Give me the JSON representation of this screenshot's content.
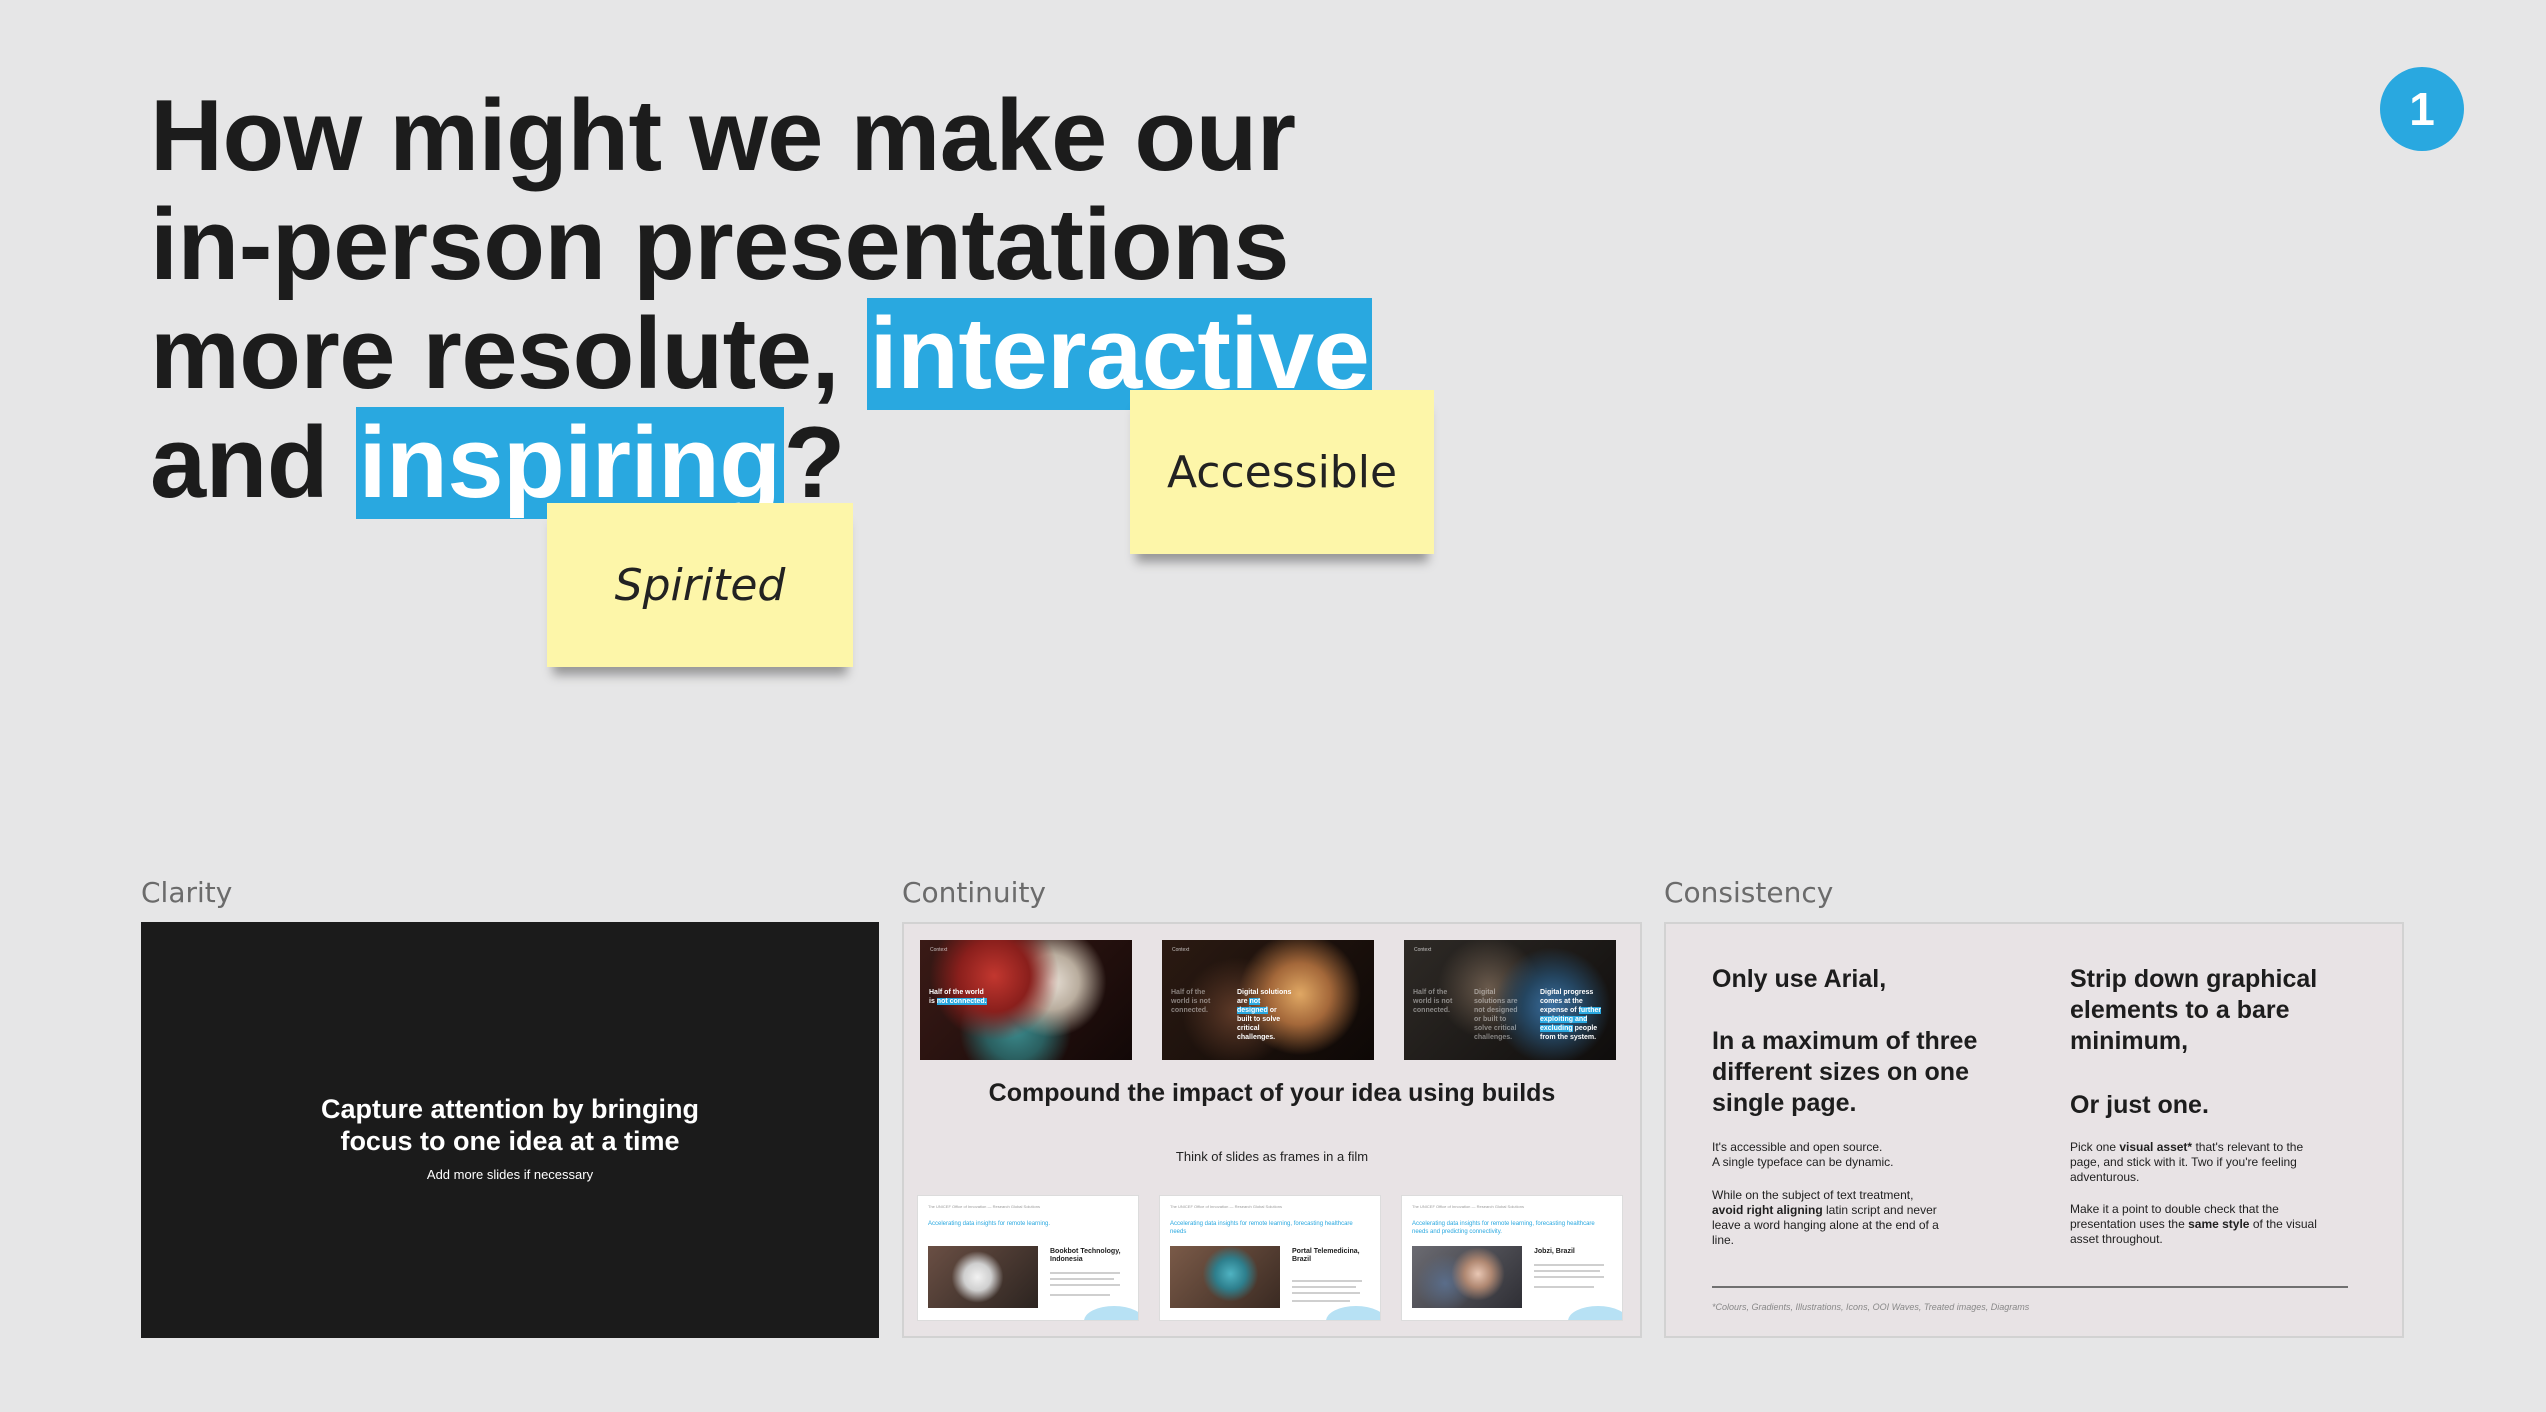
{
  "headline": {
    "line1": "How might we make our",
    "line2": "in-person presentations",
    "line3_prefix": "more resolute, ",
    "line3_highlight": "interactive",
    "line4_prefix": "and ",
    "line4_highlight": "inspiring",
    "line4_suffix": "?"
  },
  "badge": "1",
  "stickies": {
    "accessible": "Accessible",
    "spirited": "Spirited"
  },
  "colors": {
    "accent": "#29a8e0",
    "sticky": "#fdf6a9",
    "background": "#e6e6e7"
  },
  "sections": {
    "clarity": {
      "label": "Clarity",
      "title": "Capture attention by bringing focus to one idea at a time",
      "subtitle": "Add more slides if necessary"
    },
    "continuity": {
      "label": "Continuity",
      "title": "Compound the impact of your idea using builds",
      "subtitle": "Think of slides as frames in a film",
      "photo_slides": [
        {
          "label": "Context",
          "text_plain": "Half of the world is",
          "text_highlight": "not connected."
        },
        {
          "label": "Context",
          "left_plain": "Half of the world is",
          "left_highlight": "not connected.",
          "right_prefix": "Digital solutions are",
          "right_highlight": "not designed",
          "right_suffix": "or built to solve critical challenges."
        },
        {
          "label": "Context",
          "left_plain": "Half of the world is",
          "left_highlight": "not connected.",
          "mid_text": "Digital solutions are not designed or built to solve critical challenges.",
          "right_prefix": "Digital progress comes at the expense of",
          "right_highlight": "further exploiting and excluding",
          "right_suffix": "people from the system."
        }
      ],
      "doc_slides": [
        {
          "crumb": "The UNICEF Office of Innovation — Research Global Solutions",
          "heading": "Accelerating data insights for remote learning.",
          "caption": "Bookbot Technology, Indonesia"
        },
        {
          "crumb": "The UNICEF Office of Innovation — Research Global Solutions",
          "heading": "Accelerating data insights for remote learning, forecasting healthcare needs",
          "caption": "Portal Telemedicina, Brazil"
        },
        {
          "crumb": "The UNICEF Office of Innovation — Research Global Solutions",
          "heading": "Accelerating data insights for remote learning, forecasting healthcare needs and predicting connectivity.",
          "caption": "Jobzi, Brazil"
        }
      ]
    },
    "consistency": {
      "label": "Consistency",
      "left_head_1": "Only use Arial,",
      "left_head_2": "In a maximum of three different sizes on one single page.",
      "left_body_1a": "It's accessible and open source.",
      "left_body_1b": "A single typeface can be dynamic.",
      "left_body_2a": "While on the subject of text treatment,",
      "left_body_2b": "avoid right aligning",
      "left_body_2c": "latin script and never leave a word hanging alone at the end of a line.",
      "right_head_1": "Strip down graphical elements to a bare minimum,",
      "right_head_2": "Or just one.",
      "right_body_1a": "Pick one",
      "right_body_1b": "visual asset*",
      "right_body_1c": "that's relevant to the page, and stick with it. Two if you're feeling adventurous.",
      "right_body_2a": "Make it a point to double check that the presentation uses the",
      "right_body_2b": "same style",
      "right_body_2c": "of the visual asset throughout.",
      "footnote": "*Colours, Gradients, Illustrations, Icons, OOI Waves, Treated images, Diagrams"
    }
  }
}
